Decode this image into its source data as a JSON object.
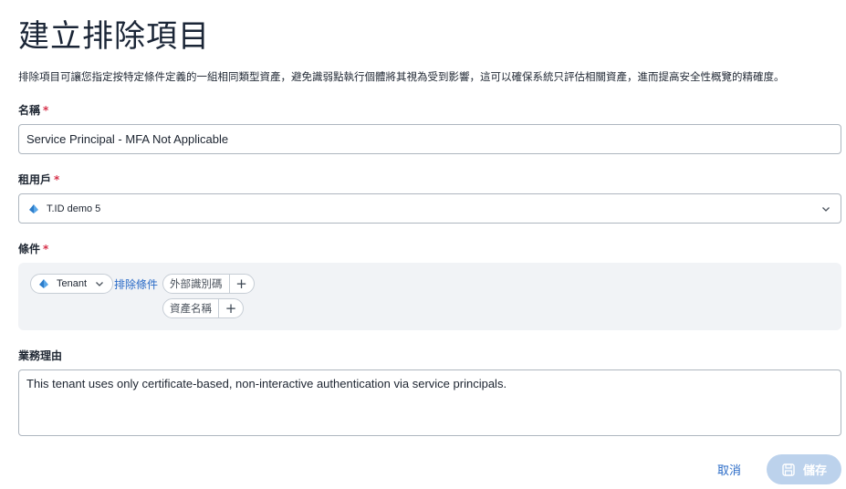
{
  "page": {
    "title": "建立排除項目",
    "description": "排除項目可讓您指定按特定條件定義的一組相同類型資產，避免識弱點執行個體將其視為受到影響，這可以確保系統只評估相關資產，進而提高安全性概覽的精確度。"
  },
  "name_field": {
    "label": "名稱",
    "required_mark": "*",
    "value": "Service Principal - MFA Not Applicable"
  },
  "tenant_field": {
    "label": "租用戶",
    "required_mark": "*",
    "value": "T.ID demo 5",
    "icon": "tenant-pyramid-icon"
  },
  "conditions": {
    "label": "條件",
    "required_mark": "*",
    "scope_value": "Tenant",
    "exclude_link": "排除條件",
    "chips": [
      {
        "label": "外部識別碼",
        "add": "+"
      },
      {
        "label": "資產名稱",
        "add": "+"
      }
    ]
  },
  "justification": {
    "label": "業務理由",
    "value": "This tenant uses only certificate-based, non-interactive authentication via service principals."
  },
  "actions": {
    "cancel_label": "取消",
    "save_label": "儲存"
  },
  "colors": {
    "accent": "#2a6bc7",
    "required": "#d6314a",
    "save_disabled": "#bcd2ec",
    "panel_bg": "#f1f3f6",
    "tenant_icon": "#3b8fd9"
  }
}
